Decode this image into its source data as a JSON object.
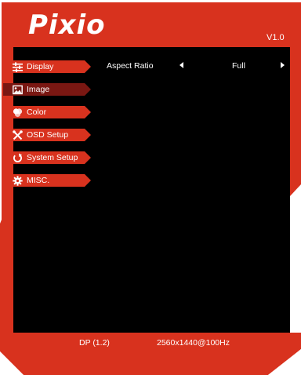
{
  "header": {
    "logo": "Pixio",
    "version": "V1.0"
  },
  "menu": [
    {
      "label": "Display",
      "icon": "sliders-icon",
      "active": false
    },
    {
      "label": "Image",
      "icon": "image-icon",
      "active": true
    },
    {
      "label": "Color",
      "icon": "palette-icon",
      "active": false
    },
    {
      "label": "OSD Setup",
      "icon": "tools-icon",
      "active": false
    },
    {
      "label": "System Setup",
      "icon": "reset-icon",
      "active": false
    },
    {
      "label": "MISC.",
      "icon": "gear-icon",
      "active": false
    }
  ],
  "setting": {
    "label": "Aspect Ratio",
    "value": "Full"
  },
  "status": {
    "input": "DP (1.2)",
    "resolution": "2560x1440@100Hz"
  },
  "colors": {
    "frame_red": "#d8321e",
    "active_tab": "#7a1712",
    "panel": "#000000"
  }
}
